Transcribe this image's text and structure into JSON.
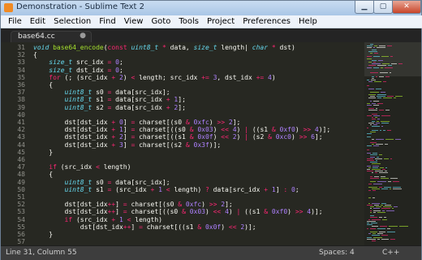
{
  "window": {
    "title": "Demonstration - Sublime Text 2",
    "minimize_glyph": "▁",
    "maximize_glyph": "▢",
    "close_glyph": "✕"
  },
  "menu": [
    "File",
    "Edit",
    "Selection",
    "Find",
    "View",
    "Goto",
    "Tools",
    "Project",
    "Preferences",
    "Help"
  ],
  "tab": {
    "label": "base64.cc",
    "close_glyph": "●"
  },
  "colors": {
    "editor_bg": "#272822",
    "keyword": "#f92672",
    "type": "#66d9ef",
    "function": "#a6e22e",
    "number": "#ae81ff",
    "text": "#f8f8f2"
  },
  "line_numbers": [
    "31",
    "32",
    "33",
    "34",
    "35",
    "36",
    "37",
    "38",
    "39",
    "40",
    "41",
    "42",
    "43",
    "44",
    "45",
    "46",
    "47",
    "48",
    "49",
    "50",
    "51",
    "52",
    "53",
    "54",
    "55",
    "56",
    "57"
  ],
  "code_lines": [
    [
      [
        "k",
        "void "
      ],
      [
        "fn",
        "base64_encode"
      ],
      [
        "t",
        "("
      ],
      [
        "kw",
        "const "
      ],
      [
        "k",
        "uint8_t "
      ],
      [
        "op",
        "* "
      ],
      [
        "t",
        "data, "
      ],
      [
        "k",
        "size_t "
      ],
      [
        "t",
        "length"
      ],
      [
        "t",
        "| "
      ],
      [
        "k",
        "char "
      ],
      [
        "op",
        "* "
      ],
      [
        "t",
        "dst)"
      ]
    ],
    [
      [
        "t",
        "{"
      ]
    ],
    [
      [
        "t",
        "    "
      ],
      [
        "k",
        "size_t "
      ],
      [
        "t",
        "src_idx "
      ],
      [
        "op",
        "= "
      ],
      [
        "num",
        "0"
      ],
      [
        "t",
        ";"
      ]
    ],
    [
      [
        "t",
        "    "
      ],
      [
        "k",
        "size_t "
      ],
      [
        "t",
        "dst_idx "
      ],
      [
        "op",
        "= "
      ],
      [
        "num",
        "0"
      ],
      [
        "t",
        ";"
      ]
    ],
    [
      [
        "t",
        "    "
      ],
      [
        "kw",
        "for "
      ],
      [
        "t",
        "(; (src_idx "
      ],
      [
        "op",
        "+ "
      ],
      [
        "num",
        "2"
      ],
      [
        "t",
        ") "
      ],
      [
        "op",
        "< "
      ],
      [
        "t",
        "length; src_idx "
      ],
      [
        "op",
        "+= "
      ],
      [
        "num",
        "3"
      ],
      [
        "t",
        ", dst_idx "
      ],
      [
        "op",
        "+= "
      ],
      [
        "num",
        "4"
      ],
      [
        "t",
        ")"
      ]
    ],
    [
      [
        "t",
        "    {"
      ]
    ],
    [
      [
        "t",
        "        "
      ],
      [
        "k",
        "uint8_t "
      ],
      [
        "t",
        "s0 "
      ],
      [
        "op",
        "= "
      ],
      [
        "t",
        "data[src_idx];"
      ]
    ],
    [
      [
        "t",
        "        "
      ],
      [
        "k",
        "uint8_t "
      ],
      [
        "t",
        "s1 "
      ],
      [
        "op",
        "= "
      ],
      [
        "t",
        "data[src_idx "
      ],
      [
        "op",
        "+ "
      ],
      [
        "num",
        "1"
      ],
      [
        "t",
        "];"
      ]
    ],
    [
      [
        "t",
        "        "
      ],
      [
        "k",
        "uint8_t "
      ],
      [
        "t",
        "s2 "
      ],
      [
        "op",
        "= "
      ],
      [
        "t",
        "data[src_idx "
      ],
      [
        "op",
        "+ "
      ],
      [
        "num",
        "2"
      ],
      [
        "t",
        "];"
      ]
    ],
    [
      [
        "t",
        ""
      ]
    ],
    [
      [
        "t",
        "        dst[dst_idx "
      ],
      [
        "op",
        "+ "
      ],
      [
        "num",
        "0"
      ],
      [
        "t",
        "] "
      ],
      [
        "op",
        "= "
      ],
      [
        "t",
        "charset[(s0 "
      ],
      [
        "op",
        "& "
      ],
      [
        "num",
        "0xfc"
      ],
      [
        "t",
        ") "
      ],
      [
        "op",
        ">> "
      ],
      [
        "num",
        "2"
      ],
      [
        "t",
        "];"
      ]
    ],
    [
      [
        "t",
        "        dst[dst_idx "
      ],
      [
        "op",
        "+ "
      ],
      [
        "num",
        "1"
      ],
      [
        "t",
        "] "
      ],
      [
        "op",
        "= "
      ],
      [
        "t",
        "charset[((s0 "
      ],
      [
        "op",
        "& "
      ],
      [
        "num",
        "0x03"
      ],
      [
        "t",
        ") "
      ],
      [
        "op",
        "<< "
      ],
      [
        "num",
        "4"
      ],
      [
        "t",
        ") "
      ],
      [
        "op",
        "| "
      ],
      [
        "t",
        "((s1 "
      ],
      [
        "op",
        "& "
      ],
      [
        "num",
        "0xf0"
      ],
      [
        "t",
        ") "
      ],
      [
        "op",
        ">> "
      ],
      [
        "num",
        "4"
      ],
      [
        "t",
        ")];"
      ]
    ],
    [
      [
        "t",
        "        dst[dst_idx "
      ],
      [
        "op",
        "+ "
      ],
      [
        "num",
        "2"
      ],
      [
        "t",
        "] "
      ],
      [
        "op",
        "= "
      ],
      [
        "t",
        "charset[((s1 "
      ],
      [
        "op",
        "& "
      ],
      [
        "num",
        "0x0f"
      ],
      [
        "t",
        ") "
      ],
      [
        "op",
        "<< "
      ],
      [
        "num",
        "2"
      ],
      [
        "t",
        ") "
      ],
      [
        "op",
        "| "
      ],
      [
        "t",
        "(s2 "
      ],
      [
        "op",
        "& "
      ],
      [
        "num",
        "0xc0"
      ],
      [
        "t",
        ") "
      ],
      [
        "op",
        ">> "
      ],
      [
        "num",
        "6"
      ],
      [
        "t",
        "];"
      ]
    ],
    [
      [
        "t",
        "        dst[dst_idx "
      ],
      [
        "op",
        "+ "
      ],
      [
        "num",
        "3"
      ],
      [
        "t",
        "] "
      ],
      [
        "op",
        "= "
      ],
      [
        "t",
        "charset[(s2 "
      ],
      [
        "op",
        "& "
      ],
      [
        "num",
        "0x3f"
      ],
      [
        "t",
        ")];"
      ]
    ],
    [
      [
        "t",
        "    }"
      ]
    ],
    [
      [
        "t",
        ""
      ]
    ],
    [
      [
        "t",
        "    "
      ],
      [
        "kw",
        "if "
      ],
      [
        "t",
        "(src_idx "
      ],
      [
        "op",
        "< "
      ],
      [
        "t",
        "length)"
      ]
    ],
    [
      [
        "t",
        "    {"
      ]
    ],
    [
      [
        "t",
        "        "
      ],
      [
        "k",
        "uint8_t "
      ],
      [
        "t",
        "s0 "
      ],
      [
        "op",
        "= "
      ],
      [
        "t",
        "data[src_idx];"
      ]
    ],
    [
      [
        "t",
        "        "
      ],
      [
        "k",
        "uint8_t "
      ],
      [
        "t",
        "s1 "
      ],
      [
        "op",
        "= "
      ],
      [
        "t",
        "(src_idx "
      ],
      [
        "op",
        "+ "
      ],
      [
        "num",
        "1 "
      ],
      [
        "op",
        "< "
      ],
      [
        "t",
        "length) "
      ],
      [
        "op",
        "? "
      ],
      [
        "t",
        "data[src_idx "
      ],
      [
        "op",
        "+ "
      ],
      [
        "num",
        "1"
      ],
      [
        "t",
        "] "
      ],
      [
        "op",
        ": "
      ],
      [
        "num",
        "0"
      ],
      [
        "t",
        ";"
      ]
    ],
    [
      [
        "t",
        ""
      ]
    ],
    [
      [
        "t",
        "        dst[dst_idx"
      ],
      [
        "op",
        "++"
      ],
      [
        "t",
        "] "
      ],
      [
        "op",
        "= "
      ],
      [
        "t",
        "charset[(s0 "
      ],
      [
        "op",
        "& "
      ],
      [
        "num",
        "0xfc"
      ],
      [
        "t",
        ") "
      ],
      [
        "op",
        ">> "
      ],
      [
        "num",
        "2"
      ],
      [
        "t",
        "];"
      ]
    ],
    [
      [
        "t",
        "        dst[dst_idx"
      ],
      [
        "op",
        "++"
      ],
      [
        "t",
        "] "
      ],
      [
        "op",
        "= "
      ],
      [
        "t",
        "charset[((s0 "
      ],
      [
        "op",
        "& "
      ],
      [
        "num",
        "0x03"
      ],
      [
        "t",
        ") "
      ],
      [
        "op",
        "<< "
      ],
      [
        "num",
        "4"
      ],
      [
        "t",
        ") "
      ],
      [
        "op",
        "| "
      ],
      [
        "t",
        "((s1 "
      ],
      [
        "op",
        "& "
      ],
      [
        "num",
        "0xf0"
      ],
      [
        "t",
        ") "
      ],
      [
        "op",
        ">> "
      ],
      [
        "num",
        "4"
      ],
      [
        "t",
        ")];"
      ]
    ],
    [
      [
        "t",
        "        "
      ],
      [
        "kw",
        "if "
      ],
      [
        "t",
        "(src_idx "
      ],
      [
        "op",
        "+ "
      ],
      [
        "num",
        "1 "
      ],
      [
        "op",
        "< "
      ],
      [
        "t",
        "length)"
      ]
    ],
    [
      [
        "t",
        "            dst[dst_idx"
      ],
      [
        "op",
        "++"
      ],
      [
        "t",
        "] "
      ],
      [
        "op",
        "= "
      ],
      [
        "t",
        "charset[((s1 "
      ],
      [
        "op",
        "& "
      ],
      [
        "num",
        "0x0f"
      ],
      [
        "t",
        ") "
      ],
      [
        "op",
        "<< "
      ],
      [
        "num",
        "2"
      ],
      [
        "t",
        ")];"
      ]
    ],
    [
      [
        "t",
        "    }"
      ]
    ],
    [
      [
        "t",
        ""
      ]
    ]
  ],
  "status": {
    "position": "Line 31, Column 55",
    "spaces": "Spaces: 4",
    "syntax": "C++"
  }
}
